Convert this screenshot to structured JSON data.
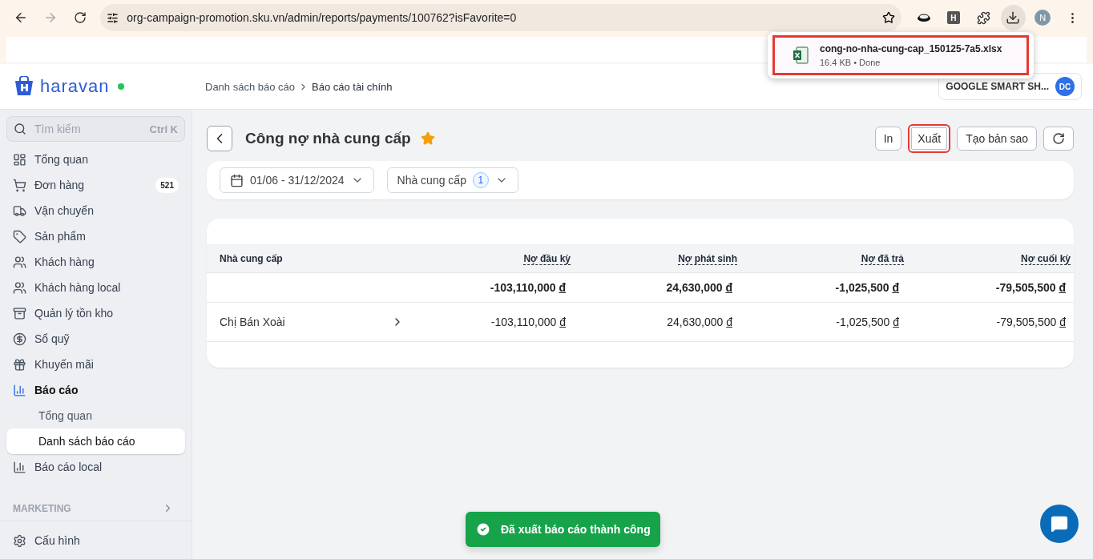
{
  "browser": {
    "url": "org-campaign-promotion.sku.vn/admin/reports/payments/100762?isFavorite=0",
    "profile": "N",
    "extension_label": "H",
    "download": {
      "filename": "cong-no-nha-cung-cap_150125-7a5.xlsx",
      "status": "16.4 KB • Done",
      "highlighted": true
    }
  },
  "header": {
    "logo": "haravan",
    "breadcrumb": [
      {
        "label": "Danh sách báo cáo",
        "current": false
      },
      {
        "label": "Báo cáo tài chính",
        "current": true
      }
    ],
    "store": "GOOGLE SMART SH...",
    "avatar": "DC"
  },
  "sidebar": {
    "search": {
      "placeholder": "Tìm kiếm",
      "shortcut": "Ctrl K"
    },
    "items": [
      {
        "kind": "grid",
        "label": "Tổng quan",
        "selected": false
      },
      {
        "kind": "cart",
        "label": "Đơn hàng",
        "badge": "521",
        "selected": false
      },
      {
        "kind": "truck",
        "label": "Vận chuyển",
        "selected": false
      },
      {
        "kind": "tag",
        "label": "Sản phẩm",
        "selected": false
      },
      {
        "kind": "users",
        "label": "Khách hàng",
        "selected": false
      },
      {
        "kind": "users",
        "label": "Khách hàng local",
        "selected": false
      },
      {
        "kind": "archive",
        "label": "Quản lý tồn kho",
        "selected": false
      },
      {
        "kind": "dollar",
        "label": "Sổ quỹ",
        "selected": false
      },
      {
        "kind": "gift",
        "label": "Khuyến mãi",
        "selected": false
      },
      {
        "kind": "chart",
        "label": "Báo cáo",
        "selected": true,
        "children": [
          {
            "label": "Tổng quan",
            "selected": false
          },
          {
            "label": "Danh sách báo cáo",
            "selected": true
          }
        ]
      },
      {
        "kind": "chart",
        "label": "Báo cáo local",
        "selected": false
      }
    ],
    "section": "MARKETING",
    "footer": {
      "kind": "gear",
      "label": "Cấu hình"
    }
  },
  "page": {
    "title": "Công nợ nhà cung cấp",
    "favorite": true,
    "actions": [
      {
        "kind": "text",
        "label": "In",
        "highlighted": false
      },
      {
        "kind": "text",
        "label": "Xuất",
        "highlighted": true
      },
      {
        "kind": "text",
        "label": "Tạo bản sao",
        "highlighted": false
      },
      {
        "kind": "refresh",
        "highlighted": false
      }
    ],
    "filters": {
      "date": "01/06 - 31/12/2024",
      "supplier": {
        "label": "Nhà cung cấp",
        "count": "1"
      }
    }
  },
  "table": {
    "columns": [
      "Nhà cung cấp",
      "Nợ đầu kỳ",
      "Nợ phát sinh",
      "Nợ đã trả",
      "Nợ cuối kỳ"
    ],
    "total": [
      {
        "amount": "-103,110,000",
        "currency": "đ"
      },
      {
        "amount": "24,630,000",
        "currency": "đ"
      },
      {
        "amount": "-1,025,500",
        "currency": "đ"
      },
      {
        "amount": "-79,505,500",
        "currency": "đ"
      }
    ],
    "rows": [
      {
        "name": "Chị Bán Xoài",
        "values": [
          {
            "amount": "-103,110,000",
            "currency": "đ"
          },
          {
            "amount": "24,630,000",
            "currency": "đ"
          },
          {
            "amount": "-1,025,500",
            "currency": "đ"
          },
          {
            "amount": "-79,505,500",
            "currency": "đ"
          }
        ]
      }
    ]
  },
  "toast": {
    "text": "Đã xuất báo cáo thành công"
  }
}
